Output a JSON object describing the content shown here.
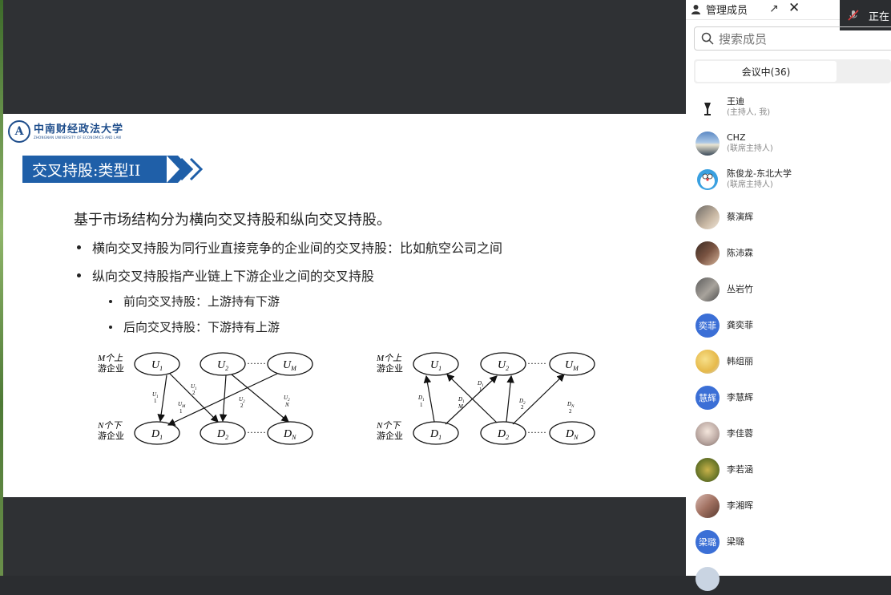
{
  "slide": {
    "logo_text": "中南财经政法大学",
    "logo_sub": "ZHONGNAN UNIVERSITY OF ECONOMICS AND LAW",
    "title": "交叉持股:类型II",
    "intro": "基于市场结构分为横向交叉持股和纵向交叉持股。",
    "bullet1": "横向交叉持股为同行业直接竞争的企业间的交叉持股：比如航空公司之间",
    "bullet2": "纵向交叉持股指产业链上下游企业之间的交叉持股",
    "sub1": "前向交叉持股：上游持有下游",
    "sub2": "后向交叉持股：下游持有上游",
    "diagram": {
      "m_label_a": "M个上",
      "m_label_b": "游企业",
      "n_label_a": "N个下",
      "n_label_b": "游企业",
      "dots": "······"
    }
  },
  "sidebar": {
    "title": "管理成员",
    "recording": "正在",
    "search_placeholder": "搜索成员",
    "tab_active": "会议中(36)",
    "members": [
      {
        "name": "王迪",
        "role": "(主持人, 我)"
      },
      {
        "name": "CHZ",
        "role": "(联席主持人)"
      },
      {
        "name": "陈俊龙-东北大学",
        "role": "(联席主持人)"
      },
      {
        "name": "蔡演辉",
        "role": ""
      },
      {
        "name": "陈沛霖",
        "role": ""
      },
      {
        "name": "丛岩竹",
        "role": ""
      },
      {
        "name": "龚奕菲",
        "role": "",
        "avatar_text": "奕菲"
      },
      {
        "name": "韩组丽",
        "role": ""
      },
      {
        "name": "李慧辉",
        "role": "",
        "avatar_text": "慧辉"
      },
      {
        "name": "李佳蓉",
        "role": ""
      },
      {
        "name": "李若涵",
        "role": ""
      },
      {
        "name": "李湘晖",
        "role": ""
      },
      {
        "name": "梁璐",
        "role": "",
        "avatar_text": "梁璐"
      }
    ]
  },
  "colors": {
    "accent_blue": "#1f5fa8",
    "avatar_blue": "#3b6fd6"
  }
}
